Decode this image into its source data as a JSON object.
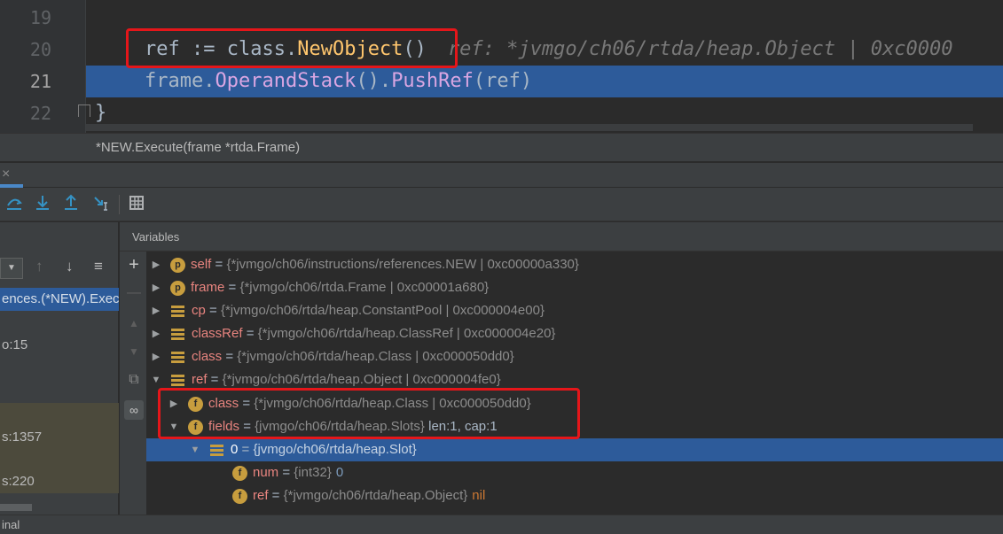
{
  "editor": {
    "line_numbers": [
      "19",
      "20",
      "21",
      "22"
    ],
    "line20": {
      "var": "ref",
      "op": " := ",
      "obj": "class.",
      "fn": "NewObject",
      "rest": "()",
      "hint": "ref: *jvmgo/ch06/rtda/heap.Object | 0xc0000"
    },
    "line21": {
      "obj": "frame.",
      "m1": "OperandStack",
      "mid": "().",
      "m2": "PushRef",
      "rest": "(ref)"
    },
    "line22": {
      "text": "}"
    },
    "breadcrumb": "*NEW.Execute(frame *rtda.Frame)"
  },
  "panel": {
    "close_glyph": "×"
  },
  "toolbar": {
    "icons": [
      "step-over-icon",
      "step-into-icon",
      "step-out-icon",
      "run-to-cursor-icon",
      "evaluate-expression-icon"
    ]
  },
  "frames": {
    "items": [
      {
        "label": "ences.(*NEW).Exec",
        "style": "sel"
      },
      {
        "label": "o:15",
        "style": "plain"
      },
      {
        "label": "s:1357",
        "style": "dim"
      },
      {
        "label": "s:220",
        "style": "dim"
      }
    ]
  },
  "variables": {
    "tab_label": "Variables",
    "rows": [
      {
        "arrow": "▶",
        "icon": "p",
        "name": "self",
        "type": "{*jvmgo/ch06/instructions/references.NEW | 0xc00000a330}",
        "extra": ""
      },
      {
        "arrow": "▶",
        "icon": "p",
        "name": "frame",
        "type": "{*jvmgo/ch06/rtda.Frame | 0xc00001a680}",
        "extra": ""
      },
      {
        "arrow": "▶",
        "icon": "list",
        "name": "cp",
        "type": "{*jvmgo/ch06/rtda/heap.ConstantPool | 0xc000004e00}",
        "extra": ""
      },
      {
        "arrow": "▶",
        "icon": "list",
        "name": "classRef",
        "type": "{*jvmgo/ch06/rtda/heap.ClassRef | 0xc000004e20}",
        "extra": ""
      },
      {
        "arrow": "▶",
        "icon": "list",
        "name": "class",
        "type": "{*jvmgo/ch06/rtda/heap.Class | 0xc000050dd0}",
        "extra": ""
      },
      {
        "arrow": "▼",
        "icon": "list",
        "name": "ref",
        "type": "{*jvmgo/ch06/rtda/heap.Object | 0xc000004fe0}",
        "extra": ""
      },
      {
        "arrow": "▶",
        "icon": "f",
        "name": "class",
        "type": "{*jvmgo/ch06/rtda/heap.Class | 0xc000050dd0}",
        "extra": ""
      },
      {
        "arrow": "▼",
        "icon": "f",
        "name": "fields",
        "type": "{jvmgo/ch06/rtda/heap.Slots}",
        "extra": " len:1, cap:1"
      },
      {
        "arrow": "▼",
        "icon": "list",
        "name": "0",
        "type": "{jvmgo/ch06/rtda/heap.Slot}",
        "extra": ""
      },
      {
        "arrow": "",
        "icon": "f",
        "name": "num",
        "type": "{int32}",
        "extra": "0"
      },
      {
        "arrow": "",
        "icon": "f",
        "name": "ref",
        "type": "{*jvmgo/ch06/rtda/heap.Object}",
        "extra": "nil"
      }
    ],
    "eq": " = "
  },
  "status": {
    "text": "inal"
  },
  "colors": {
    "highlight": "#2d5b9a",
    "annotation_red": "#e5161a",
    "var_name": "#e8847f",
    "icon_gold": "#c79d3e"
  }
}
